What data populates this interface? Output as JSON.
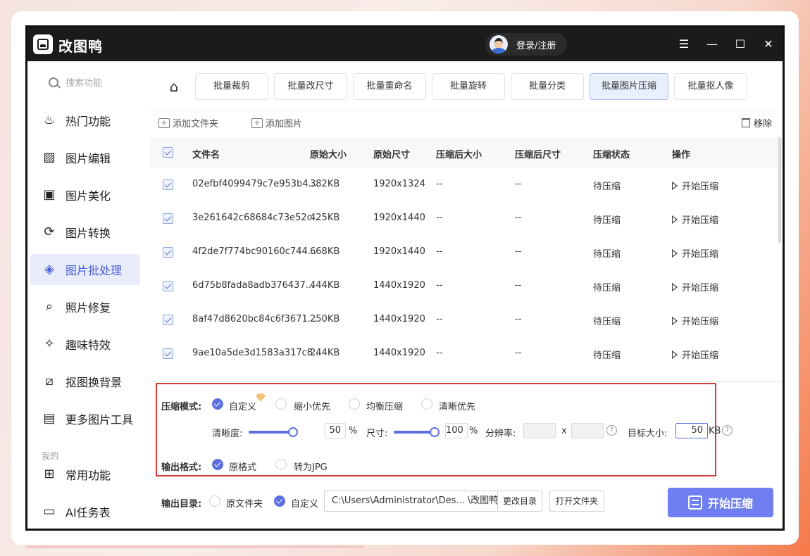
{
  "app": {
    "title": "改图鸭",
    "user_label": "登录/注册"
  },
  "window": {
    "menu_icon": "menu-icon",
    "minimize_icon": "minimize-icon",
    "maximize_icon": "maximize-icon",
    "close_icon": "close-icon"
  },
  "sidebar": {
    "search_placeholder": "搜索功能",
    "items": [
      {
        "label": "热门功能",
        "icon": "flame-icon"
      },
      {
        "label": "图片编辑",
        "icon": "image-edit-icon"
      },
      {
        "label": "图片美化",
        "icon": "image-beautify-icon"
      },
      {
        "label": "图片转换",
        "icon": "convert-icon"
      },
      {
        "label": "图片批处理",
        "icon": "batch-icon",
        "active": true
      },
      {
        "label": "照片修复",
        "icon": "photo-repair-icon"
      },
      {
        "label": "趣味特效",
        "icon": "magic-wand-icon"
      },
      {
        "label": "抠图换背景",
        "icon": "cutout-icon"
      },
      {
        "label": "更多图片工具",
        "icon": "toolbox-icon"
      }
    ],
    "section_label": "我的",
    "my_items": [
      {
        "label": "常用功能",
        "icon": "grid-icon"
      },
      {
        "label": "AI任务表",
        "icon": "task-list-icon"
      }
    ]
  },
  "tabs": [
    {
      "label": "批量裁剪"
    },
    {
      "label": "批量改尺寸"
    },
    {
      "label": "批量重命名"
    },
    {
      "label": "批量旋转"
    },
    {
      "label": "批量分类"
    },
    {
      "label": "批量图片压缩",
      "active": true
    },
    {
      "label": "批量抠人像"
    }
  ],
  "toolbar": {
    "add_folder": "添加文件夹",
    "add_image": "添加图片",
    "remove": "移除"
  },
  "table": {
    "headers": [
      "文件名",
      "原始大小",
      "原始尺寸",
      "压缩后大小",
      "压缩后尺寸",
      "压缩状态",
      "操作"
    ],
    "rows": [
      {
        "name": "02efbf4099479c7e953b4...",
        "size": "382KB",
        "dim": "1920x1324",
        "csize": "--",
        "cdim": "--",
        "status": "待压缩",
        "action": "开始压缩"
      },
      {
        "name": "3e261642c68684c73e52c...",
        "size": "425KB",
        "dim": "1920x1440",
        "csize": "--",
        "cdim": "--",
        "status": "待压缩",
        "action": "开始压缩"
      },
      {
        "name": "4f2de7f774bc90160c744...",
        "size": "668KB",
        "dim": "1920x1440",
        "csize": "--",
        "cdim": "--",
        "status": "待压缩",
        "action": "开始压缩"
      },
      {
        "name": "6d75b8fada8adb376437...",
        "size": "444KB",
        "dim": "1440x1920",
        "csize": "--",
        "cdim": "--",
        "status": "待压缩",
        "action": "开始压缩"
      },
      {
        "name": "8af47d8620bc84c6f3671...",
        "size": "250KB",
        "dim": "1440x1920",
        "csize": "--",
        "cdim": "--",
        "status": "待压缩",
        "action": "开始压缩"
      },
      {
        "name": "9ae10a5de3d1583a317c8...",
        "size": "244KB",
        "dim": "1440x1920",
        "csize": "--",
        "cdim": "--",
        "status": "待压缩",
        "action": "开始压缩"
      }
    ]
  },
  "settings": {
    "mode_label": "压缩模式:",
    "modes": [
      "自定义",
      "缩小优先",
      "均衡压缩",
      "清晰优先"
    ],
    "selected_mode": "自定义",
    "clarity_label": "清晰度:",
    "clarity_value": "50",
    "size_label": "尺寸:",
    "size_value": "100",
    "percent": "%",
    "resolution_label": "分辨率:",
    "resolution_x": "x",
    "target_label": "目标大小:",
    "target_value": "50",
    "target_unit": "KB",
    "format_label": "输出格式:",
    "formats": [
      "原格式",
      "转为JPG"
    ],
    "selected_format": "原格式"
  },
  "output": {
    "dir_label": "输出目录:",
    "options": [
      "原文件夹",
      "自定义"
    ],
    "selected": "自定义",
    "path": "C:\\Users\\Administrator\\Des... \\改图鸭",
    "change_dir": "更改目录",
    "open_folder": "打开文件夹",
    "start": "开始压缩"
  }
}
